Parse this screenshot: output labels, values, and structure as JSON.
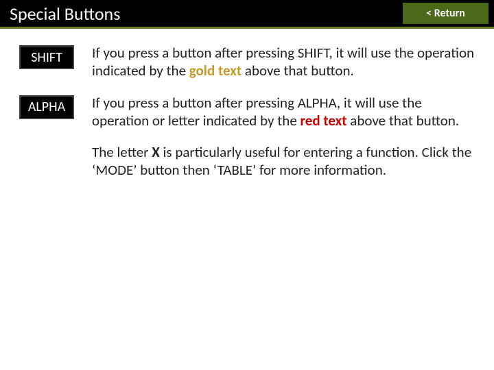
{
  "header": {
    "title": "Special Buttons",
    "return_label": "< Return"
  },
  "rows": {
    "shift": {
      "button": "SHIFT",
      "pre": "If you press a button after pressing SHIFT, it will use the operation indicated by the ",
      "em": "gold text",
      "post": " above that button."
    },
    "alpha": {
      "button": "ALPHA",
      "pre": "If you press a button after pressing ALPHA, it will use the operation or letter indicated by the ",
      "em": "red text",
      "post": " above that button."
    },
    "note": {
      "pre": "The letter ",
      "em": "X",
      "post": " is particularly useful for entering a function. Click the ‘MODE’ button then ‘TABLE’ for more information."
    }
  }
}
